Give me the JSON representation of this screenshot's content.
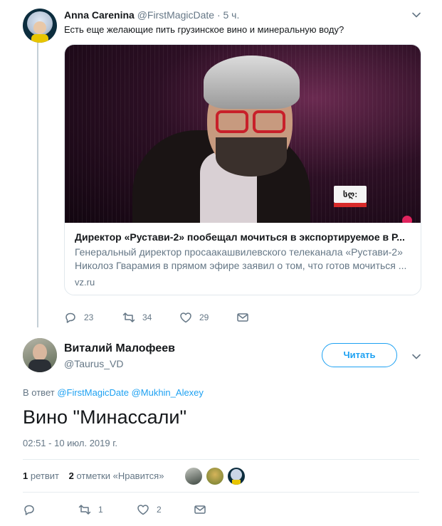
{
  "parent_tweet": {
    "author_name": "Anna Carenina",
    "author_handle": "@FirstMagicDate",
    "separator": "·",
    "time": "5 ч.",
    "text": "Есть еще желающие пить грузинское вино и минеральную воду?",
    "card": {
      "title": "Директор «Рустави-2» пообещал мочиться в экспортируемое в Р...",
      "description": "Генеральный директор просаакашвилевского телеканала «Рустави-2» Николоз Гварамия в прямом эфире заявил о том, что готов мочиться ...",
      "domain": "vz.ru",
      "channel_logo_text": "სღ:"
    },
    "actions": {
      "replies": "23",
      "retweets": "34",
      "likes": "29"
    }
  },
  "focused_tweet": {
    "author_name": "Виталий Малофеев",
    "author_handle": "@Taurus_VD",
    "follow_label": "Читать",
    "reply_prefix": "В ответ",
    "reply_mentions": [
      "@FirstMagicDate",
      "@Mukhin_Alexey"
    ],
    "text": "Вино \"Минассали\"",
    "timestamp": "02:51 - 10 июл. 2019 г.",
    "stats": {
      "retweet_count": "1",
      "retweet_label": "ретвит",
      "like_count": "2",
      "like_label": "отметки «Нравится»"
    },
    "actions": {
      "replies": "",
      "retweets": "1",
      "likes": "2"
    }
  },
  "colors": {
    "accent": "#1da1f2",
    "secondary_text": "#657786",
    "primary_text": "#14171a",
    "border": "#e1e8ed"
  },
  "icons": [
    "caret-down-icon",
    "reply-icon",
    "retweet-icon",
    "heart-icon",
    "envelope-icon"
  ]
}
